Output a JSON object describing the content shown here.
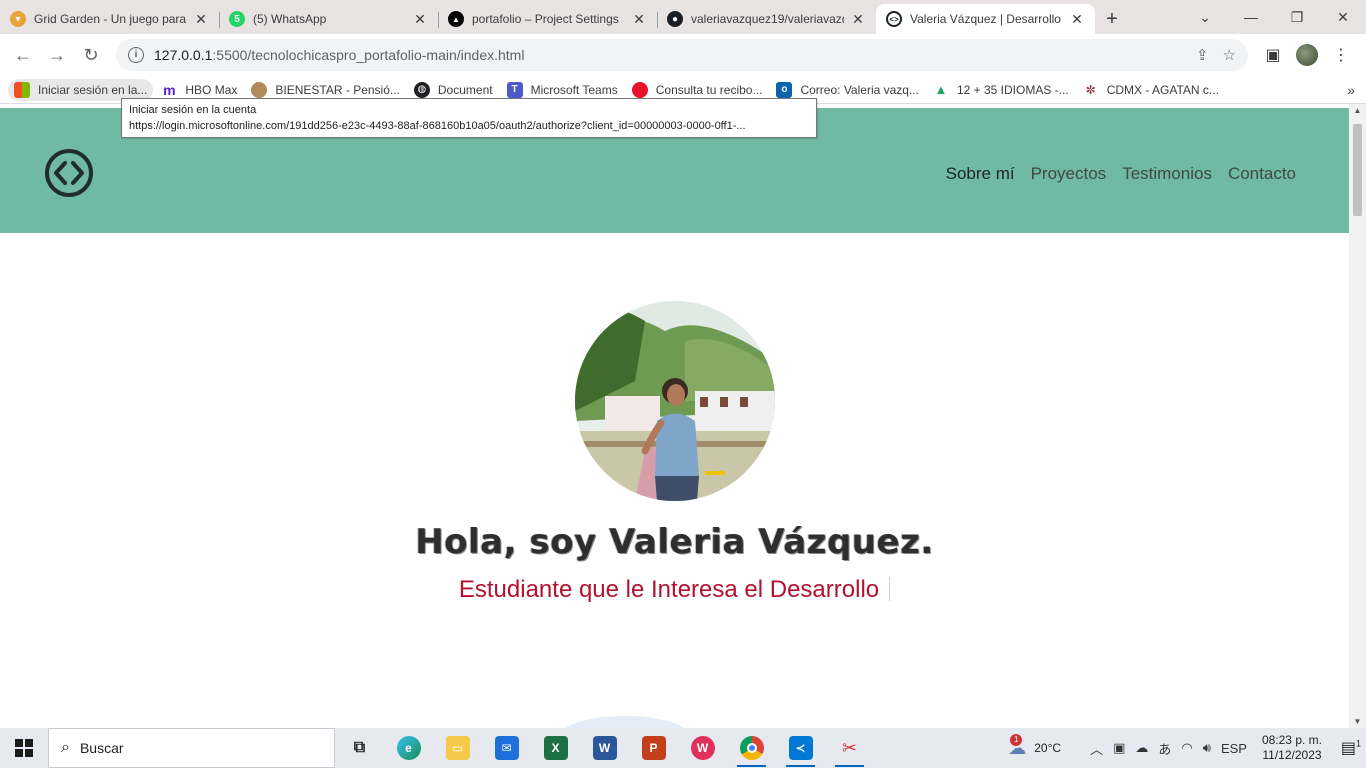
{
  "browser": {
    "tabs": [
      {
        "title": "Grid Garden - Un juego para",
        "favicon": "carrot-icon",
        "color": "#e8a33a",
        "active": false
      },
      {
        "title": "(5) WhatsApp",
        "favicon": "whatsapp-icon",
        "color": "#25d366",
        "badge": "5",
        "active": false
      },
      {
        "title": "portafolio – Project Settings",
        "favicon": "vercel-icon",
        "color": "#000000",
        "active": false
      },
      {
        "title": "valeriavazquez19/valeriavazq",
        "favicon": "github-icon",
        "color": "#1b1f23",
        "active": false
      },
      {
        "title": "Valeria Vázquez | Desarrollo",
        "favicon": "code-logo-icon",
        "color": "#1b2624",
        "active": true
      }
    ],
    "url_host": "127.0.0.1",
    "url_path": ":5500/tecnolochicaspro_portafolio-main/index.html",
    "bookmarks": [
      {
        "label": "Iniciar sesión en la...",
        "icon": "microsoft-icon"
      },
      {
        "label": "HBO Max",
        "icon": "hbomax-icon"
      },
      {
        "label": "BIENESTAR - Pensió...",
        "icon": "bienestar-icon"
      },
      {
        "label": "Document",
        "icon": "globe-icon"
      },
      {
        "label": "Microsoft Teams",
        "icon": "teams-icon"
      },
      {
        "label": "Consulta tu recibo...",
        "icon": "red-circle-icon"
      },
      {
        "label": "Correo: Valeria vazq...",
        "icon": "outlook-icon"
      },
      {
        "label": "12 + 35 IDIOMAS -...",
        "icon": "google-drive-icon"
      },
      {
        "label": "CDMX - AGATAN c...",
        "icon": "cdmx-icon"
      }
    ],
    "tooltip": {
      "title": "Iniciar sesión en la cuenta",
      "url": "https://login.microsoftonline.com/191dd256-e23c-4493-88af-868160b10a05/oauth2/authorize?client_id=00000003-0000-0ff1-..."
    }
  },
  "site": {
    "nav": [
      "Sobre mí",
      "Proyectos",
      "Testimonios",
      "Contacto"
    ],
    "header_color": "#70b9a3",
    "hero_title": "Hola, soy Valeria Vázquez.",
    "hero_subtitle": "Estudiante que le Interesa el Desarrollo",
    "accent_color": "#b3122f"
  },
  "taskbar": {
    "search_placeholder": "Buscar",
    "apps": [
      "task-view-icon",
      "edge-icon",
      "file-explorer-icon",
      "mail-icon",
      "excel-icon",
      "word-icon",
      "powerpoint-icon",
      "wps-icon",
      "chrome-icon",
      "vscode-icon",
      "snipping-tool-icon"
    ],
    "weather_temp": "20°C",
    "weather_badge": "1",
    "language": "ESP",
    "time": "08:23 p. m.",
    "date": "11/12/2023",
    "notification_count": "1"
  }
}
